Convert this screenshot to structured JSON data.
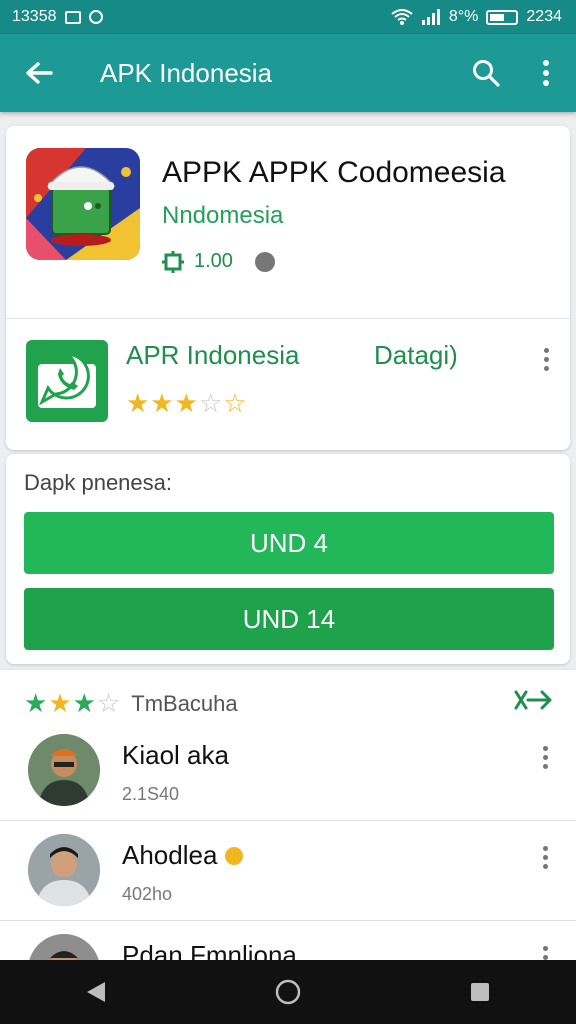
{
  "status_bar": {
    "time": "13358",
    "battery": "8°%",
    "clock": "2234"
  },
  "app_bar": {
    "title": "APK Indonesia"
  },
  "hero": {
    "title": "APPK APPK Codomeesia",
    "subtitle": "Nndomesia",
    "count": "1.00"
  },
  "subapp": {
    "name": "APR Indonesia",
    "action": "Datagi)",
    "rating": 3.5
  },
  "section": {
    "label": "Dapk pnenesa:",
    "button1": "UND 4",
    "button2": "UND 14"
  },
  "reviews": {
    "header": "TmBacuha",
    "items": [
      {
        "name": "Kiaol aka",
        "time": "2.1S40"
      },
      {
        "name": "Ahodlea",
        "time": "402ho"
      },
      {
        "name": "Pdan Fmnliona",
        "time": ""
      }
    ]
  },
  "colors": {
    "teal": "#1d9a95",
    "green": "#22b85a",
    "star": "#f2b620"
  }
}
